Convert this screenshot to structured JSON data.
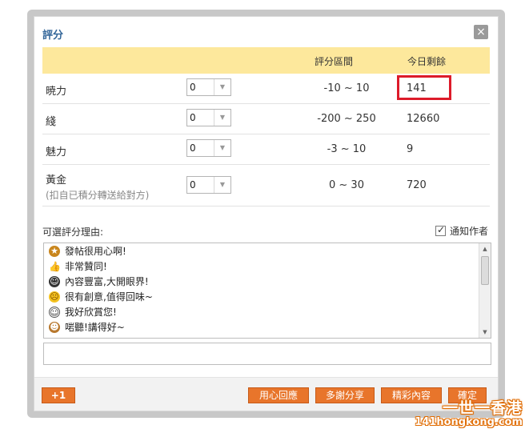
{
  "dialog": {
    "title": "評分",
    "close_icon": "close-icon ×"
  },
  "table": {
    "headers": {
      "range": "評分區間",
      "remaining": "今日剩餘"
    },
    "rows": [
      {
        "label": "暁力",
        "sub": "",
        "value": "0",
        "range": "-10 ~ 10",
        "remaining": "141"
      },
      {
        "label": "綫",
        "sub": "",
        "value": "0",
        "range": "-200 ~ 250",
        "remaining": "12660"
      },
      {
        "label": "魅力",
        "sub": "",
        "value": "0",
        "range": "-3 ~ 10",
        "remaining": "9"
      },
      {
        "label": "黃金",
        "sub": "(扣自已積分轉送給對方)",
        "value": "0",
        "range": "0 ~ 30",
        "remaining": "720"
      }
    ]
  },
  "reasons": {
    "label": "可選評分理由:",
    "notify_label": "通知作者",
    "notify_checked": true,
    "items": [
      {
        "icon": "medal-icon",
        "text": "發帖很用心啊!"
      },
      {
        "icon": "thumbs-up-icon",
        "text": "非常贊同!"
      },
      {
        "icon": "cool-face-icon",
        "text": "內容豐富,大開眼界!"
      },
      {
        "icon": "confused-face-icon",
        "text": "很有創意,值得回味~"
      },
      {
        "icon": "smile-face-icon",
        "text": "我好欣賞您!"
      },
      {
        "icon": "monkey-face-icon",
        "text": "啱聽!講得好~"
      }
    ],
    "input_value": ""
  },
  "footer": {
    "plus_label": "+1",
    "buttons": [
      "用心回應",
      "多謝分享",
      "精彩內容",
      "確定"
    ]
  },
  "watermark": {
    "main": "一世一香港",
    "sub": "141hongkong.com"
  },
  "colors": {
    "header_bg": "#fde89c",
    "accent_orange": "#e8752b",
    "highlight_red": "#dd1b2a",
    "title_blue": "#336699"
  }
}
